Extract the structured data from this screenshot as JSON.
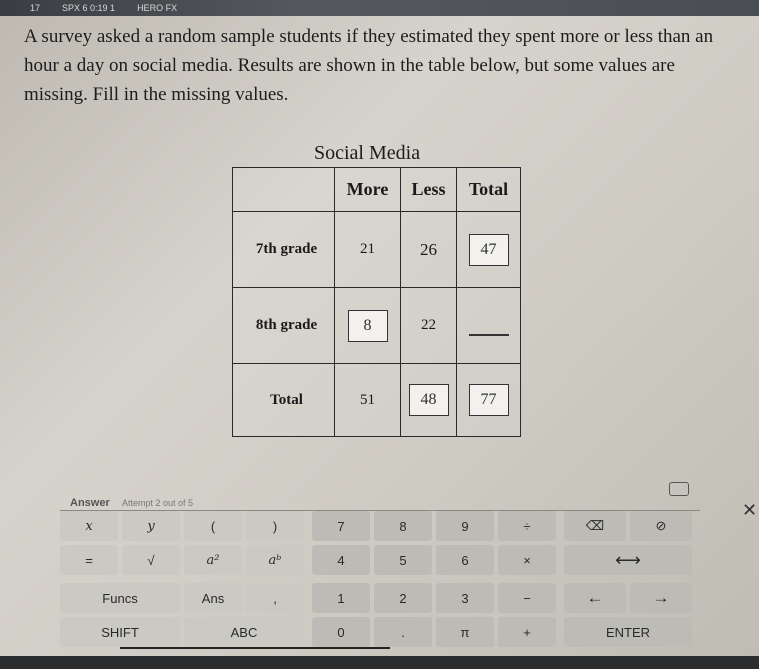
{
  "topbar": {
    "items": [
      "17",
      "SPX 6 0:19 1",
      "HERO FX"
    ]
  },
  "question": "A survey asked a random sample students if they estimated they spent more or less than an hour a day on social media. Results are shown in the table below, but some values are missing. Fill in the missing values.",
  "table": {
    "title": "Social Media",
    "headers": [
      "More",
      "Less",
      "Total"
    ],
    "rows": [
      {
        "label": "7th grade",
        "more": "21",
        "less": "26",
        "total": "47"
      },
      {
        "label": "8th grade",
        "more": "8",
        "less": "22",
        "total": ""
      },
      {
        "label": "Total",
        "more": "51",
        "less": "48",
        "total": "77"
      }
    ]
  },
  "answer": {
    "label": "Answer",
    "attempt": "Attempt 2 out of 5"
  },
  "keypad": {
    "row1": [
      "x",
      "y",
      "(",
      ")",
      "7",
      "8",
      "9",
      "÷"
    ],
    "row2": [
      "=",
      "√",
      "a²",
      "aᵇ",
      "4",
      "5",
      "6",
      "×"
    ],
    "row3": [
      "Funcs",
      "Ans",
      ",",
      "1",
      "2",
      "3",
      "−"
    ],
    "row4": [
      "SHIFT",
      "ABC",
      "0",
      ".",
      "π",
      "+"
    ],
    "backspace": "⌫",
    "clear": "⊘",
    "resize": "⟷",
    "left_arrow": "←",
    "right_arrow": "→",
    "enter": "ENTER",
    "close": "✕"
  }
}
